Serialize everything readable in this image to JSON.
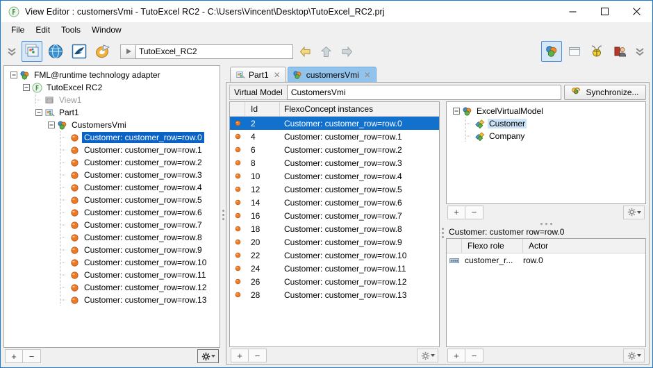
{
  "window": {
    "title": "View Editor : customersVmi - TutoExcel RC2 - C:\\Users\\Vincent\\Desktop\\TutoExcel_RC2.prj",
    "app_icon": "openflexo-icon",
    "minimize_label": "—",
    "maximize_label": "□",
    "close_label": "✕"
  },
  "menu": {
    "items": [
      "File",
      "Edit",
      "Tools",
      "Window"
    ]
  },
  "toolbar": {
    "left_chevrons_icon": "double-chevron-down-icon",
    "icons": [
      "images-editor-icon",
      "globe-icon",
      "bird-icon",
      "palette-icon"
    ],
    "play_icon": "play-icon",
    "address_value": "TutoExcel_RC2",
    "address_placeholder": "",
    "back_icon": "arrow-left-icon",
    "up_icon": "arrow-up-icon",
    "forward_icon": "arrow-right-icon",
    "right_icons": [
      "virtual-model-icon",
      "window-icon",
      "bug-icon",
      "user-icon"
    ],
    "right_chevrons_icon": "double-chevron-down-icon"
  },
  "left_tree": {
    "nodes": [
      {
        "label": "FML@runtime technology adapter",
        "depth": 0,
        "toggle": "minus",
        "icon": "virtual-model-icon"
      },
      {
        "label": "TutoExcel RC2",
        "depth": 1,
        "toggle": "minus",
        "icon": "project-icon"
      },
      {
        "label": "View1",
        "depth": 2,
        "toggle": "none",
        "icon": "view-icon",
        "gray": true
      },
      {
        "label": "Part1",
        "depth": 2,
        "toggle": "minus",
        "icon": "part-icon"
      },
      {
        "label": "CustomersVmi",
        "depth": 3,
        "toggle": "minus",
        "icon": "virtual-model-icon"
      },
      {
        "label": "Customer: customer_row=row.0",
        "depth": 4,
        "toggle": "none",
        "icon": "instance-icon",
        "selected": true
      },
      {
        "label": "Customer: customer_row=row.1",
        "depth": 4,
        "toggle": "none",
        "icon": "instance-icon"
      },
      {
        "label": "Customer: customer_row=row.2",
        "depth": 4,
        "toggle": "none",
        "icon": "instance-icon"
      },
      {
        "label": "Customer: customer_row=row.3",
        "depth": 4,
        "toggle": "none",
        "icon": "instance-icon"
      },
      {
        "label": "Customer: customer_row=row.4",
        "depth": 4,
        "toggle": "none",
        "icon": "instance-icon"
      },
      {
        "label": "Customer: customer_row=row.5",
        "depth": 4,
        "toggle": "none",
        "icon": "instance-icon"
      },
      {
        "label": "Customer: customer_row=row.6",
        "depth": 4,
        "toggle": "none",
        "icon": "instance-icon"
      },
      {
        "label": "Customer: customer_row=row.7",
        "depth": 4,
        "toggle": "none",
        "icon": "instance-icon"
      },
      {
        "label": "Customer: customer_row=row.8",
        "depth": 4,
        "toggle": "none",
        "icon": "instance-icon"
      },
      {
        "label": "Customer: customer_row=row.9",
        "depth": 4,
        "toggle": "none",
        "icon": "instance-icon"
      },
      {
        "label": "Customer: customer_row=row.10",
        "depth": 4,
        "toggle": "none",
        "icon": "instance-icon"
      },
      {
        "label": "Customer: customer_row=row.11",
        "depth": 4,
        "toggle": "none",
        "icon": "instance-icon"
      },
      {
        "label": "Customer: customer_row=row.12",
        "depth": 4,
        "toggle": "none",
        "icon": "instance-icon"
      },
      {
        "label": "Customer: customer_row=row.13",
        "depth": 4,
        "toggle": "none",
        "icon": "instance-icon"
      }
    ]
  },
  "tabs": [
    {
      "label": "Part1",
      "icon": "part-icon",
      "active": false,
      "close": "✕"
    },
    {
      "label": "customersVmi",
      "icon": "virtual-model-icon",
      "active": true,
      "close": "✕"
    }
  ],
  "virtual_model": {
    "label": "Virtual Model",
    "value": "CustomersVmi",
    "sync_label": "Synchronize...",
    "sync_icon": "synchronize-icon"
  },
  "instances_table": {
    "columns": [
      "",
      "Id",
      "FlexoConcept instances"
    ],
    "rows": [
      {
        "icon": "instance-icon",
        "id": "2",
        "name": "Customer: customer_row=row.0",
        "selected": true
      },
      {
        "icon": "instance-icon",
        "id": "4",
        "name": "Customer: customer_row=row.1"
      },
      {
        "icon": "instance-icon",
        "id": "6",
        "name": "Customer: customer_row=row.2"
      },
      {
        "icon": "instance-icon",
        "id": "8",
        "name": "Customer: customer_row=row.3"
      },
      {
        "icon": "instance-icon",
        "id": "10",
        "name": "Customer: customer_row=row.4"
      },
      {
        "icon": "instance-icon",
        "id": "12",
        "name": "Customer: customer_row=row.5"
      },
      {
        "icon": "instance-icon",
        "id": "14",
        "name": "Customer: customer_row=row.6"
      },
      {
        "icon": "instance-icon",
        "id": "16",
        "name": "Customer: customer_row=row.7"
      },
      {
        "icon": "instance-icon",
        "id": "18",
        "name": "Customer: customer_row=row.8"
      },
      {
        "icon": "instance-icon",
        "id": "20",
        "name": "Customer: customer_row=row.9"
      },
      {
        "icon": "instance-icon",
        "id": "22",
        "name": "Customer: customer_row=row.10"
      },
      {
        "icon": "instance-icon",
        "id": "24",
        "name": "Customer: customer_row=row.11"
      },
      {
        "icon": "instance-icon",
        "id": "26",
        "name": "Customer: customer_row=row.12"
      },
      {
        "icon": "instance-icon",
        "id": "28",
        "name": "Customer: customer_row=row.13"
      }
    ]
  },
  "concept_tree": {
    "nodes": [
      {
        "label": "ExcelVirtualModel",
        "depth": 0,
        "toggle": "minus",
        "icon": "virtual-model-icon"
      },
      {
        "label": "Customer",
        "depth": 1,
        "toggle": "none",
        "icon": "flexo-concept-icon",
        "selected": true
      },
      {
        "label": "Company",
        "depth": 1,
        "toggle": "none",
        "icon": "flexo-concept-icon"
      }
    ]
  },
  "detail": {
    "title": "Customer: customer row=row.0",
    "columns": [
      "",
      "Flexo role",
      "Actor"
    ],
    "rows": [
      {
        "icon": "role-icon",
        "role": "customer_r...",
        "actor": "row.0"
      }
    ]
  },
  "footers": {
    "add_label": "+",
    "remove_label": "−",
    "gear_icon": "gear-icon",
    "caret_icon": "caret-down-icon"
  }
}
